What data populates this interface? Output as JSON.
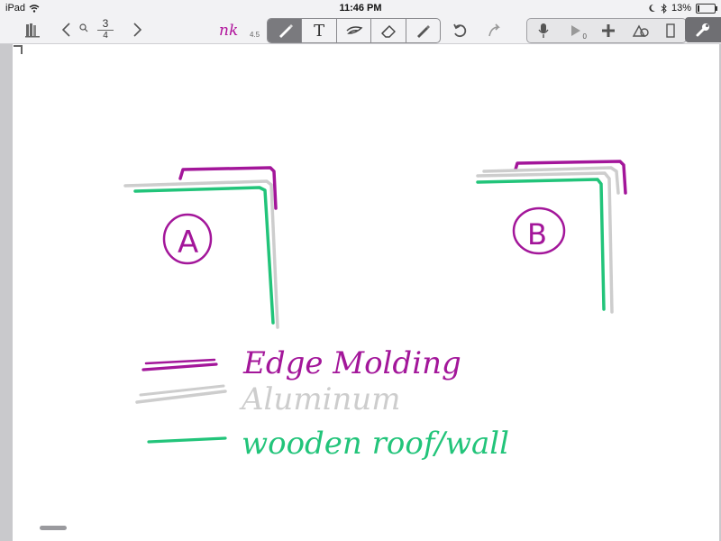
{
  "status_bar": {
    "carrier": "iPad",
    "time": "11:46 PM",
    "battery": "13%",
    "battery_level": 0.13
  },
  "toolbar": {
    "page_current": "3",
    "page_total": "4",
    "brand": "nk",
    "brand_version": "4.5",
    "tools": [
      {
        "name": "pen",
        "label": "",
        "active": true
      },
      {
        "name": "text",
        "label": "T",
        "active": false
      },
      {
        "name": "lasso",
        "label": "",
        "active": false
      },
      {
        "name": "eraser",
        "label": "",
        "active": false
      },
      {
        "name": "highlighter",
        "label": "",
        "active": false
      }
    ],
    "play_count": "0"
  },
  "canvas": {
    "labels": {
      "a": "A",
      "b": "B",
      "legend_1": "Edge Molding",
      "legend_2": "Aluminum",
      "legend_3": "wooden roof/wall"
    },
    "colors": {
      "purple": "#a3169a",
      "gray": "#cdcdcd",
      "green": "#22c47a"
    }
  }
}
